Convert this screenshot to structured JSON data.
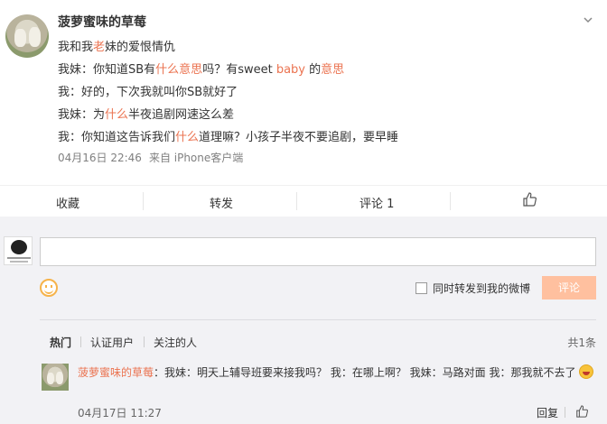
{
  "post": {
    "username": "菠萝蜜味的草莓",
    "lines": [
      [
        {
          "t": "我和我"
        },
        {
          "t": "老",
          "hl": true
        },
        {
          "t": "妹的爱恨情仇"
        }
      ],
      [
        {
          "t": "我妹：你知道SB有"
        },
        {
          "t": "什么意思",
          "hl": true
        },
        {
          "t": "吗？有sweet "
        },
        {
          "t": "baby",
          "hl": true
        },
        {
          "t": " 的"
        },
        {
          "t": "意思",
          "hl": true
        }
      ],
      [
        {
          "t": "我：好的，下次我就叫你SB就好了"
        }
      ],
      [
        {
          "t": "我妹：为"
        },
        {
          "t": "什么",
          "hl": true
        },
        {
          "t": "半夜追剧网速这么差"
        }
      ],
      [
        {
          "t": "我：你知道这告诉我们"
        },
        {
          "t": "什么",
          "hl": true
        },
        {
          "t": "道理嘛？小孩子半夜不要追剧，要早睡"
        }
      ]
    ],
    "time": "04月16日 22:46",
    "source": "来自 iPhone客户端"
  },
  "actions": {
    "favorite": "收藏",
    "repost": "转发",
    "comment": "评论 1"
  },
  "compose": {
    "repost_label": "同时转发到我的微博",
    "submit_label": "评论"
  },
  "comments": {
    "filters": [
      "热门",
      "认证用户",
      "关注的人"
    ],
    "total": "共1条",
    "items": [
      {
        "user": "菠萝蜜味的草莓",
        "text": "：我妹：明天上辅导班要来接我吗？ 我：在哪上啊？ 我妹：马路对面 我：那我就不去了",
        "time": "04月17日 11:27",
        "reply": "回复"
      }
    ]
  },
  "colors": {
    "accent": "#eb7350",
    "submit_bg": "#ffc09f",
    "comment_bg": "#f2f2f5"
  }
}
